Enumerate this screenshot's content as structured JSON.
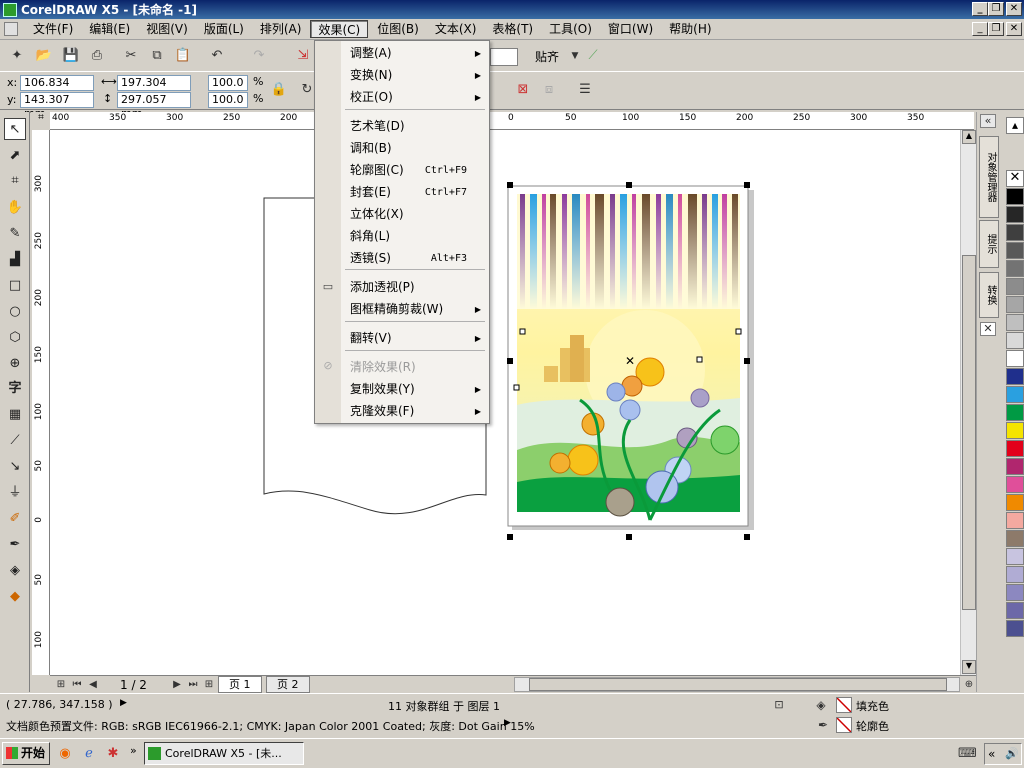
{
  "window": {
    "title": "CorelDRAW X5 - [未命名 -1]"
  },
  "menubar": {
    "items": [
      "文件(F)",
      "编辑(E)",
      "视图(V)",
      "版面(L)",
      "排列(A)",
      "效果(C)",
      "位图(B)",
      "文本(X)",
      "表格(T)",
      "工具(O)",
      "窗口(W)",
      "帮助(H)"
    ],
    "active_index": 5
  },
  "effects_menu": {
    "items": [
      {
        "label": "调整(A)",
        "shortcut": "",
        "submenu": true,
        "disabled": false
      },
      {
        "label": "变换(N)",
        "shortcut": "",
        "submenu": true,
        "disabled": false
      },
      {
        "label": "校正(O)",
        "shortcut": "",
        "submenu": true,
        "disabled": false
      },
      {
        "label": "艺术笔(D)",
        "shortcut": "",
        "submenu": false,
        "disabled": false
      },
      {
        "label": "调和(B)",
        "shortcut": "",
        "submenu": false,
        "disabled": false
      },
      {
        "label": "轮廓图(C)",
        "shortcut": "Ctrl+F9",
        "submenu": false,
        "disabled": false
      },
      {
        "label": "封套(E)",
        "shortcut": "Ctrl+F7",
        "submenu": false,
        "disabled": false
      },
      {
        "label": "立体化(X)",
        "shortcut": "",
        "submenu": false,
        "disabled": false
      },
      {
        "label": "斜角(L)",
        "shortcut": "",
        "submenu": false,
        "disabled": false
      },
      {
        "label": "透镜(S)",
        "shortcut": "Alt+F3",
        "submenu": false,
        "disabled": false
      },
      {
        "label": "添加透视(P)",
        "shortcut": "",
        "submenu": false,
        "disabled": false
      },
      {
        "label": "图框精确剪裁(W)",
        "shortcut": "",
        "submenu": true,
        "disabled": false
      },
      {
        "label": "翻转(V)",
        "shortcut": "",
        "submenu": true,
        "disabled": false
      },
      {
        "label": "清除效果(R)",
        "shortcut": "",
        "submenu": false,
        "disabled": true
      },
      {
        "label": "复制效果(Y)",
        "shortcut": "",
        "submenu": true,
        "disabled": false
      },
      {
        "label": "克隆效果(F)",
        "shortcut": "",
        "submenu": true,
        "disabled": false
      }
    ]
  },
  "toolbar": {
    "snap_label": "贴齐"
  },
  "propbar": {
    "x_label": "x:",
    "x_value": "106.834 mm",
    "y_label": "y:",
    "y_value": "143.307 mm",
    "w_value": "197.304 mm",
    "h_value": "297.057 mm",
    "scale_x": "100.0",
    "scale_y": "100.0",
    "pct": "%"
  },
  "hruler": {
    "ticks": [
      "400",
      "350",
      "300",
      "250",
      "200",
      "150",
      "100",
      "50",
      "0",
      "50",
      "100",
      "150",
      "200",
      "250",
      "300",
      "350"
    ],
    "unit": "毫米"
  },
  "vruler": {
    "ticks": [
      "300",
      "250",
      "200",
      "150",
      "100",
      "50",
      "0",
      "50",
      "100"
    ]
  },
  "pages": {
    "counter": "1 / 2",
    "tabs": [
      "页 1",
      "页 2"
    ]
  },
  "dockers": {
    "tabs": [
      "对象管理器",
      "提示",
      "转换"
    ]
  },
  "palette": {
    "colors": [
      "#000000",
      "#262626",
      "#3f3f3f",
      "#595959",
      "#737373",
      "#8c8c8c",
      "#a6a6a6",
      "#bfbfbf",
      "#d9d9d9",
      "#ffffff",
      "#1f2f8c",
      "#2aa0e0",
      "#009a44",
      "#f5e400",
      "#e2001a",
      "#b0266e",
      "#e04f9a",
      "#f08a00",
      "#f4a9a0",
      "#8d7a6a",
      "#c8c4e0",
      "#b0acd4",
      "#8c88c0",
      "#6c68a8",
      "#4c5090"
    ]
  },
  "status": {
    "coords": "( 27.786, 347.158 )",
    "selection": "11 对象群组 于 图层 1",
    "fill_label": "填充色",
    "outline_label": "轮廓色",
    "color_profile": "文档颜色预置文件: RGB: sRGB IEC61966-2.1; CMYK: Japan Color 2001 Coated; 灰度: Dot Gain 15%"
  },
  "taskbar": {
    "start": "开始",
    "task": "CorelDRAW X5 - [未..."
  },
  "colors": {
    "title_start": "#0a246a",
    "title_end": "#3a6ea5",
    "chrome": "#d4d0c8",
    "menu_bg": "#f4f2ee"
  }
}
